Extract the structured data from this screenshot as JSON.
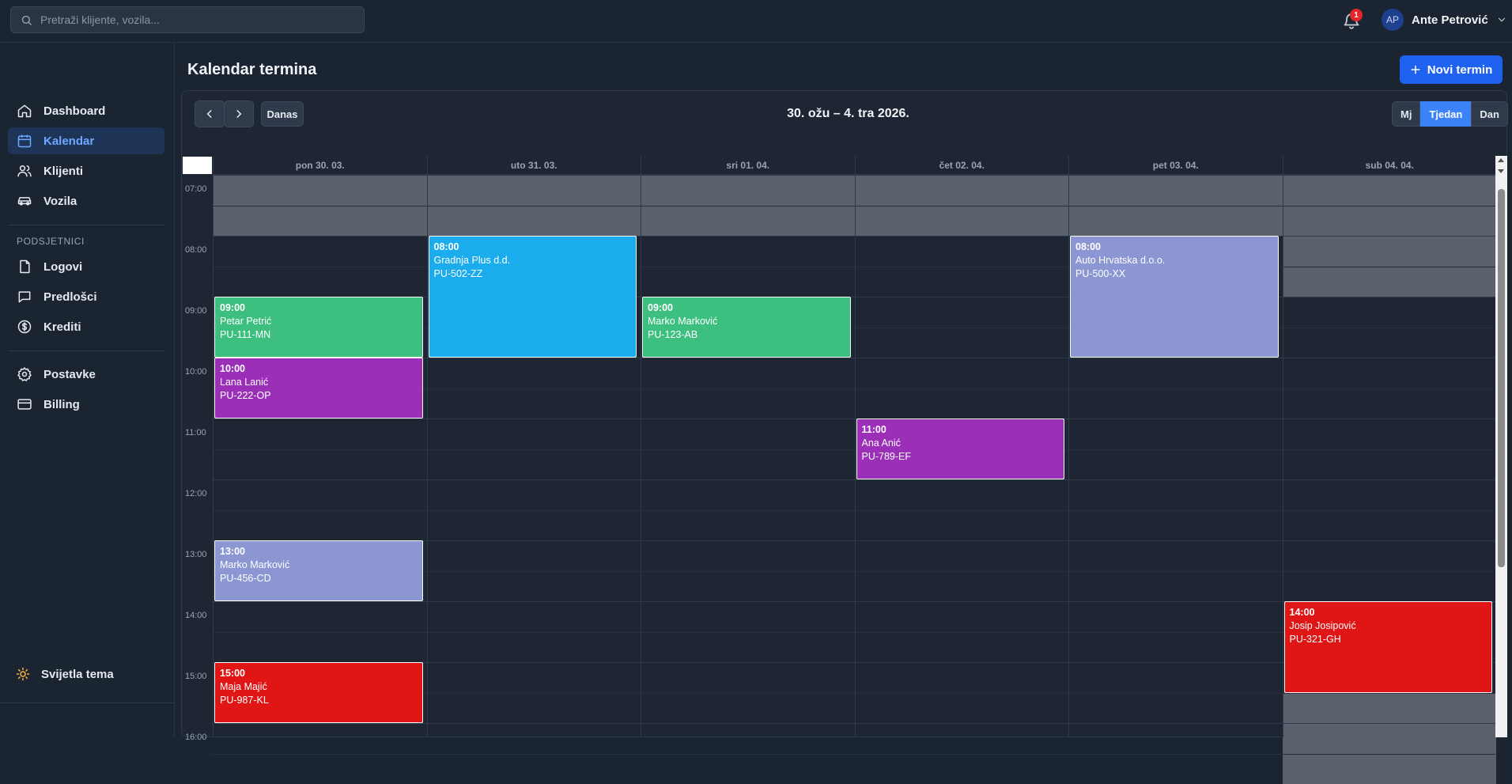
{
  "search": {
    "placeholder": "Pretraži klijente, vozila..."
  },
  "notifications": {
    "count": "1"
  },
  "user": {
    "initials": "AP",
    "name": "Ante Petrović"
  },
  "sidebar": {
    "items": [
      {
        "label": "Dashboard"
      },
      {
        "label": "Kalendar"
      },
      {
        "label": "Klijenti"
      },
      {
        "label": "Vozila"
      }
    ],
    "section_label": "PODSJETNICI",
    "section_items": [
      {
        "label": "Logovi"
      },
      {
        "label": "Predlošci"
      },
      {
        "label": "Krediti"
      }
    ],
    "settings_items": [
      {
        "label": "Postavke"
      },
      {
        "label": "Billing"
      }
    ],
    "theme_label": "Svijetla tema"
  },
  "page": {
    "title": "Kalendar termina",
    "new_button": "Novi termin"
  },
  "calendar": {
    "today_label": "Danas",
    "range_title": "30. ožu – 4. tra 2026.",
    "views": [
      "Mj",
      "Tjedan",
      "Dan"
    ],
    "active_view": "Tjedan",
    "days": [
      "pon 30. 03.",
      "uto 31. 03.",
      "sri 01. 04.",
      "čet 02. 04.",
      "pet 03. 04.",
      "sub 04. 04."
    ],
    "hours": [
      "07:00",
      "08:00",
      "09:00",
      "10:00",
      "11:00",
      "12:00",
      "13:00",
      "14:00",
      "15:00",
      "16:00"
    ],
    "events": [
      {
        "day": 0,
        "start": "09:00",
        "duration_h": 1,
        "client": "Petar Petrić",
        "plate": "PU-111-MN",
        "color": "#3dbf80"
      },
      {
        "day": 0,
        "start": "10:00",
        "duration_h": 1,
        "client": "Lana Lanić",
        "plate": "PU-222-OP",
        "color": "#9b2fb8"
      },
      {
        "day": 0,
        "start": "13:00",
        "duration_h": 1,
        "client": "Marko Marković",
        "plate": "PU-456-CD",
        "color": "#8b96d3"
      },
      {
        "day": 0,
        "start": "15:00",
        "duration_h": 1,
        "client": "Maja Majić",
        "plate": "PU-987-KL",
        "color": "#e01616"
      },
      {
        "day": 1,
        "start": "08:00",
        "duration_h": 2,
        "client": "Gradnja Plus d.d.",
        "plate": "PU-502-ZZ",
        "color": "#1aacec"
      },
      {
        "day": 2,
        "start": "09:00",
        "duration_h": 1,
        "client": "Marko Marković",
        "plate": "PU-123-AB",
        "color": "#3dbf80"
      },
      {
        "day": 3,
        "start": "11:00",
        "duration_h": 1,
        "client": "Ana Anić",
        "plate": "PU-789-EF",
        "color": "#9b2fb8"
      },
      {
        "day": 4,
        "start": "08:00",
        "duration_h": 2,
        "client": "Auto Hrvatska d.o.o.",
        "plate": "PU-500-XX",
        "color": "#8b96d3"
      },
      {
        "day": 5,
        "start": "14:00",
        "duration_h": 1.5,
        "client": "Josip Josipović",
        "plate": "PU-321-GH",
        "color": "#e01616"
      }
    ],
    "closed_color": "#5a616c"
  }
}
